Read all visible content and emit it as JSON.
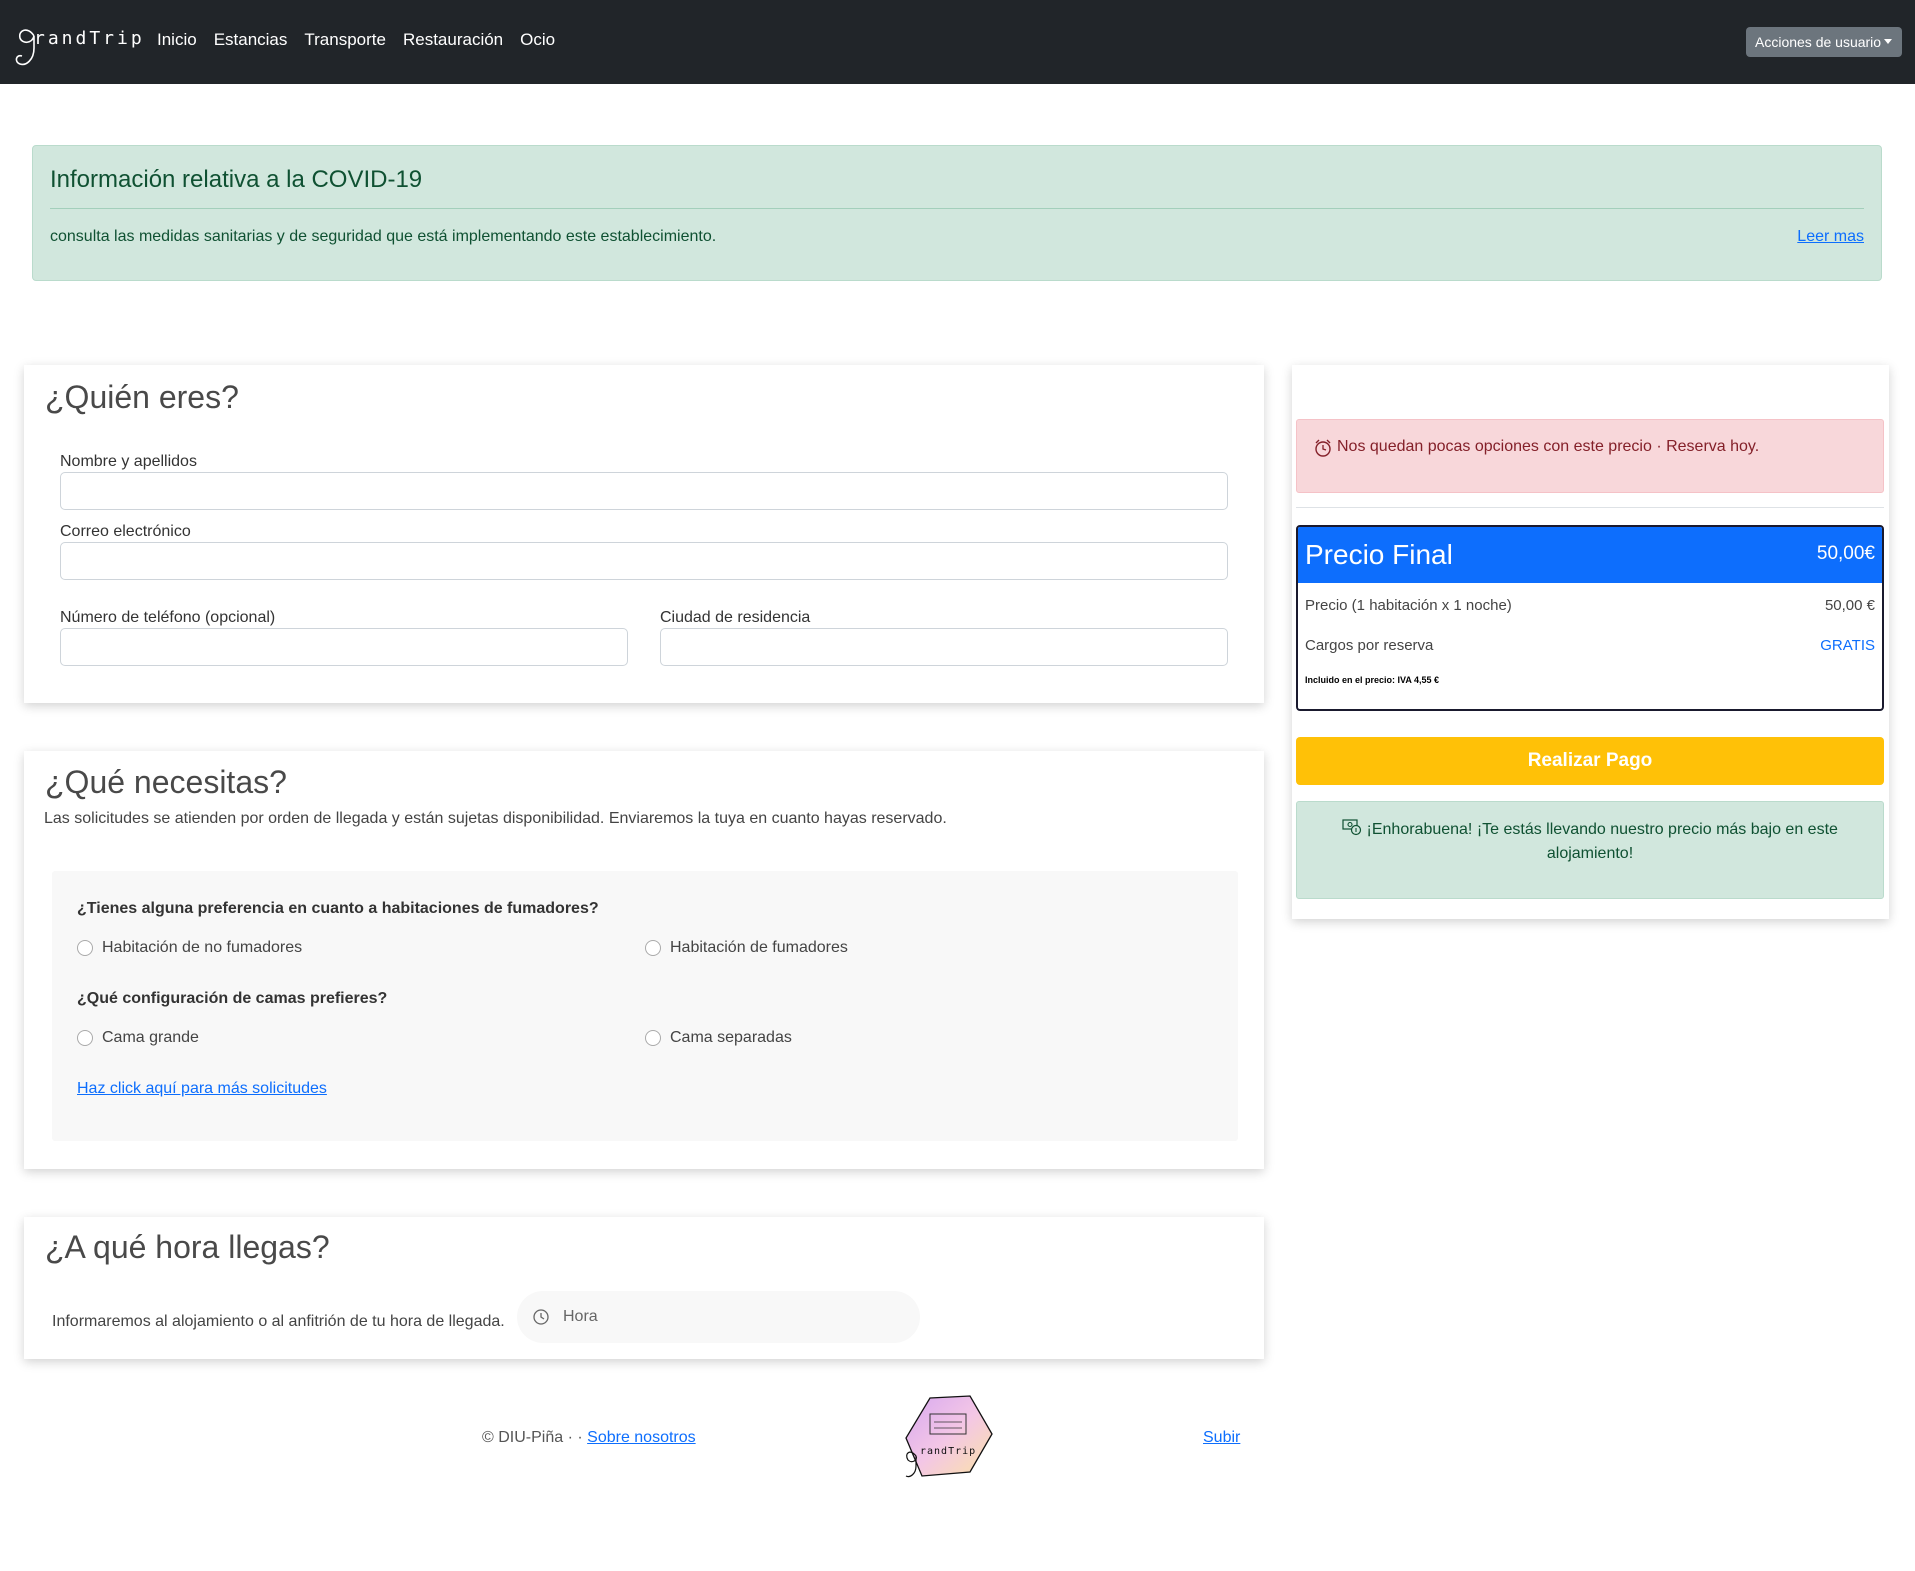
{
  "navbar": {
    "brand": "randTrip",
    "links": [
      "Inicio",
      "Estancias",
      "Transporte",
      "Restauración",
      "Ocio"
    ],
    "user_menu": "Acciones de usuario"
  },
  "covid": {
    "title": "Información relativa a la COVID-19",
    "text": "consulta las medidas sanitarias y de seguridad que está implementando este establecimiento.",
    "link": "Leer mas"
  },
  "who": {
    "title": "¿Quién eres?",
    "name_label": "Nombre y apellidos",
    "email_label": "Correo electrónico",
    "phone_label": "Número de teléfono (opcional)",
    "city_label": "Ciudad de residencia"
  },
  "needs": {
    "title": "¿Qué necesitas?",
    "description": "Las solicitudes se atienden por orden de llegada y están sujetas disponibilidad. Enviaremos la tuya en cuanto hayas reservado.",
    "smoking_question": "¿Tienes alguna preferencia en cuanto a habitaciones de fumadores?",
    "smoking_options": [
      "Habitación de no fumadores",
      "Habitación de fumadores"
    ],
    "bed_question": "¿Qué configuración de camas prefieres?",
    "bed_options": [
      "Cama grande",
      "Cama separadas"
    ],
    "more_link": "Haz click aquí para más solicitudes"
  },
  "arrival": {
    "title": "¿A qué hora llegas?",
    "description": "Informaremos al alojamiento o al anfitrión de tu hora de llegada.",
    "time_placeholder": "Hora"
  },
  "sidebar": {
    "warning": "Nos quedan pocas opciones con este precio · Reserva hoy.",
    "price_title": "Precio Final",
    "price_total": "50,00€",
    "rows": [
      {
        "label": "Precio (1 habitación x 1 noche)",
        "value": "50,00 €"
      },
      {
        "label": "Cargos por reserva",
        "value": "GRATIS"
      }
    ],
    "iva_note": "Incluido en el precio: IVA 4,55 €",
    "pay_button": "Realizar Pago",
    "congrats": "¡Enhorabuena! ¡Te estás llevando nuestro precio más bajo en este alojamiento!"
  },
  "footer": {
    "copyright": "© DIU-Piña · ·",
    "about_link": "Sobre nosotros",
    "logo_text": "randTrip",
    "up_link": "Subir"
  },
  "icons": {
    "warning": "alarm-clock-icon",
    "congrats": "cash-coin-icon",
    "time": "clock-icon",
    "caret": "caret-down-icon"
  },
  "colors": {
    "navbar": "#212529",
    "primary": "#0d6efd",
    "warning_button": "#ffc107",
    "success_bg": "#d1e7dd",
    "danger_bg": "#f8d7da"
  }
}
